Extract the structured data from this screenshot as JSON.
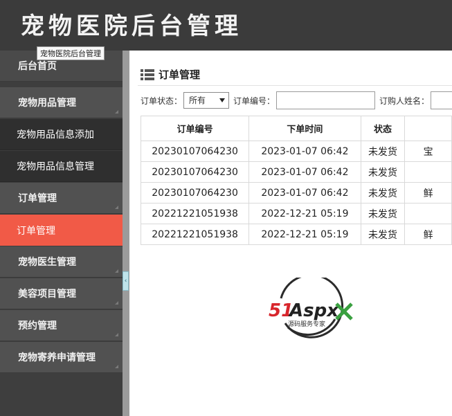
{
  "header": {
    "title": "宠物医院后台管理"
  },
  "tooltip": "宠物医院后台管理",
  "sidebar": {
    "items": [
      {
        "label": "后台首页"
      },
      {
        "label": "宠物用品管理"
      },
      {
        "label": "宠物用品信息添加"
      },
      {
        "label": "宠物用品信息管理"
      },
      {
        "label": "订单管理"
      },
      {
        "label": "订单管理"
      },
      {
        "label": "宠物医生管理"
      },
      {
        "label": "美容项目管理"
      },
      {
        "label": "预约管理"
      },
      {
        "label": "宠物寄养申请管理"
      }
    ],
    "active_color": "#f15a47"
  },
  "main": {
    "title": "订单管理",
    "filters": {
      "status_label": "订单状态：",
      "status_value": "所有",
      "order_no_label": "订单编号：",
      "order_no_value": "",
      "buyer_label": "订购人姓名：",
      "buyer_value": ""
    },
    "table": {
      "columns": [
        "订单编号",
        "下单时间",
        "状态",
        ""
      ],
      "rows": [
        [
          "20230107064230",
          "2023-01-07 06:42",
          "未发货",
          "宝"
        ],
        [
          "20230107064230",
          "2023-01-07 06:42",
          "未发货",
          ""
        ],
        [
          "20230107064230",
          "2023-01-07 06:42",
          "未发货",
          "鲜"
        ],
        [
          "20221221051938",
          "2022-12-21 05:19",
          "未发货",
          ""
        ],
        [
          "20221221051938",
          "2022-12-21 05:19",
          "未发货",
          "鲜"
        ]
      ]
    },
    "watermark": {
      "brand_num": "51",
      "brand_text": "Aspx",
      "tagline": "源码服务专家"
    }
  }
}
